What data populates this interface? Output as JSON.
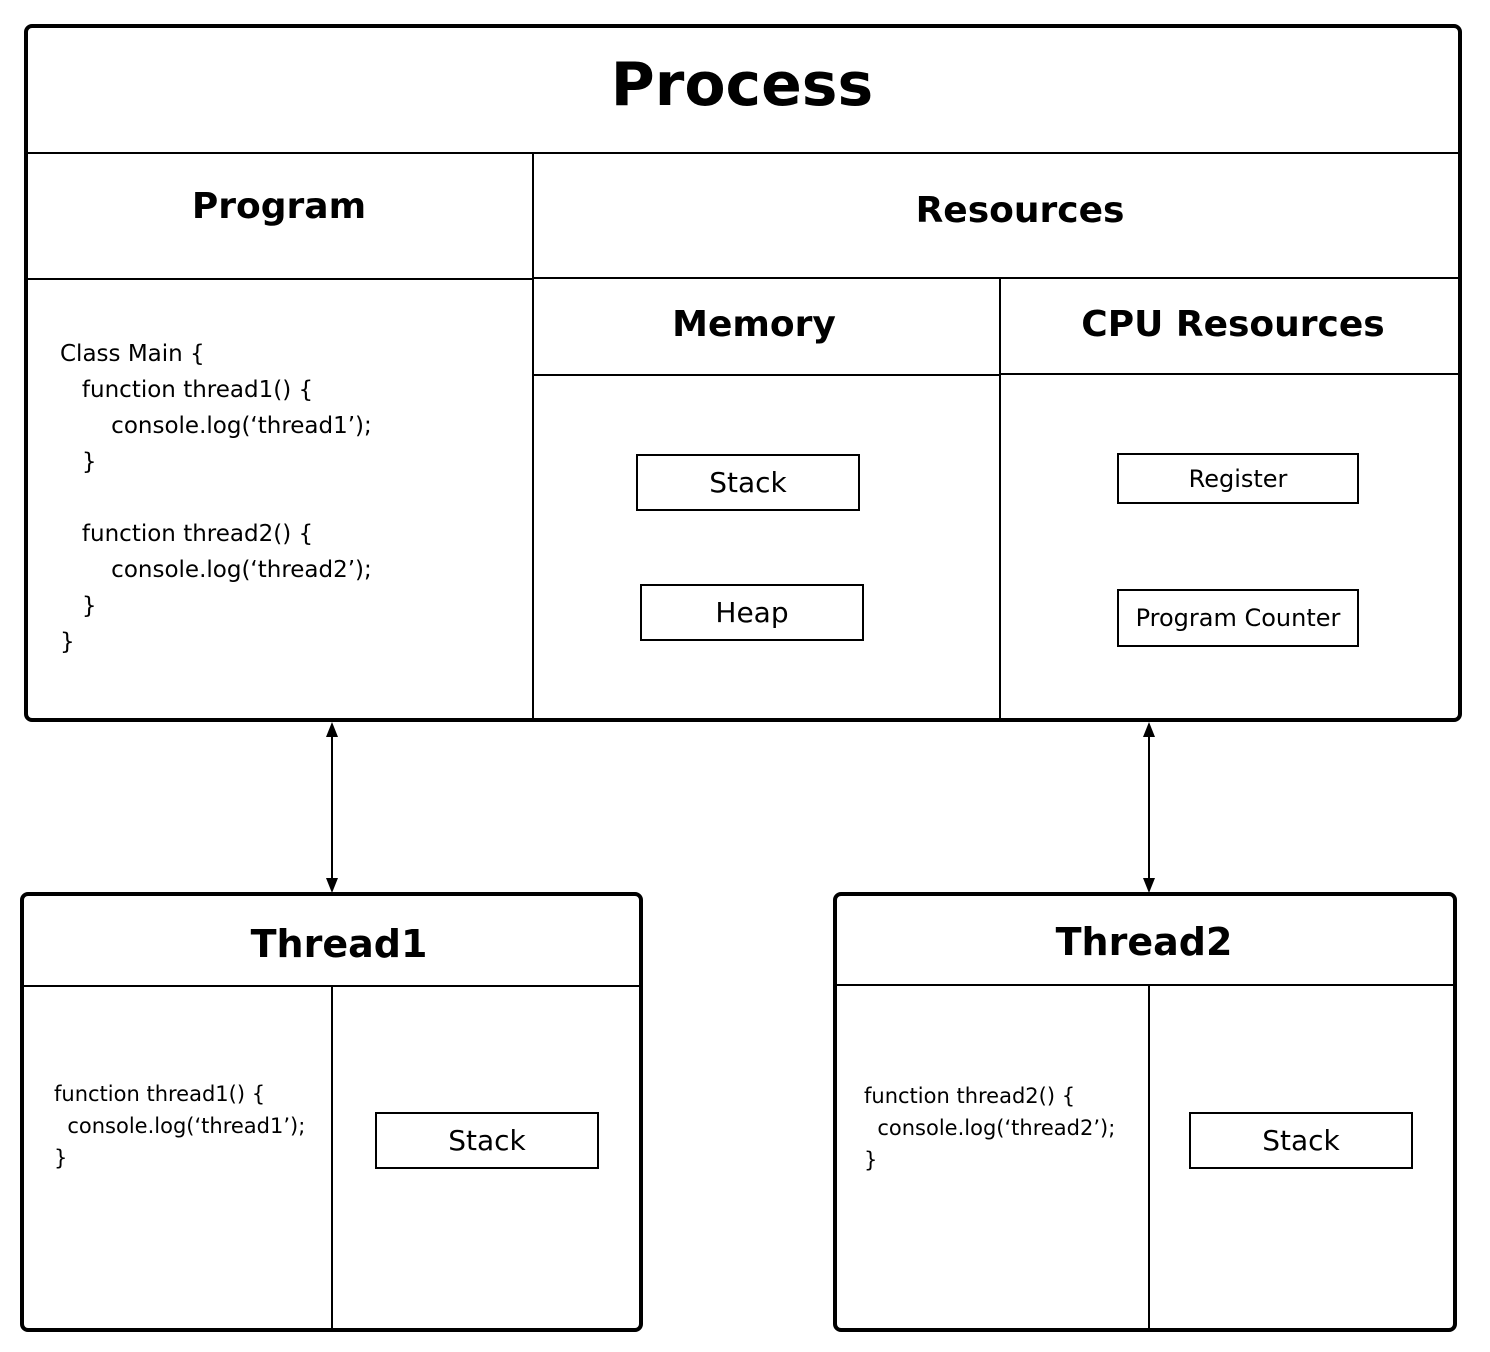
{
  "process": {
    "title": "Process",
    "program": {
      "title": "Program",
      "code": "Class Main {\n   function thread1() {\n       console.log(‘thread1’);\n   }\n\n   function thread2() {\n       console.log(‘thread2’);\n   }\n}"
    },
    "resources": {
      "title": "Resources",
      "memory": {
        "title": "Memory",
        "items": [
          "Stack",
          "Heap"
        ]
      },
      "cpu": {
        "title": "CPU Resources",
        "items": [
          "Register",
          "Program Counter"
        ]
      }
    }
  },
  "threads": [
    {
      "title": "Thread1",
      "code": "function thread1() {\n  console.log(‘thread1’);\n}",
      "stack_label": "Stack"
    },
    {
      "title": "Thread2",
      "code": "function thread2() {\n  console.log(‘thread2’);\n}",
      "stack_label": "Stack"
    }
  ],
  "connections": [
    {
      "from": "Process.Program",
      "to": "Thread1",
      "type": "bidirectional"
    },
    {
      "from": "Process.CPU Resources",
      "to": "Thread2",
      "type": "bidirectional"
    }
  ]
}
